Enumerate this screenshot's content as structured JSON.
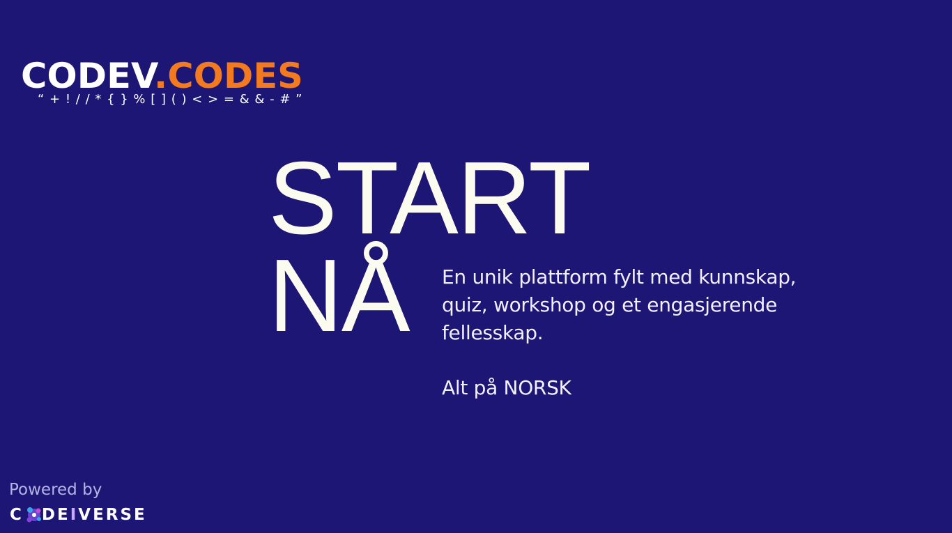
{
  "logo": {
    "part1": "CODEV",
    "part2": ".CODES",
    "symbols": "“ + ! / / * { } % [ ] ( ) < > = & & - # ”"
  },
  "hero": {
    "line1": "START",
    "line2": "NÅ"
  },
  "description": "En unik plattform fylt med kunnskap, quiz, workshop og et engasjerende fellesskap.",
  "tagline": "Alt på NORSK",
  "footer": {
    "powered_by": "Powered by",
    "brand_part1": "C",
    "brand_part2": "DE",
    "brand_accent": "I",
    "brand_part3": "VERSE"
  },
  "colors": {
    "background": "#1e1675",
    "accent_orange": "#f47a1f",
    "text_light": "#fbfbef"
  }
}
